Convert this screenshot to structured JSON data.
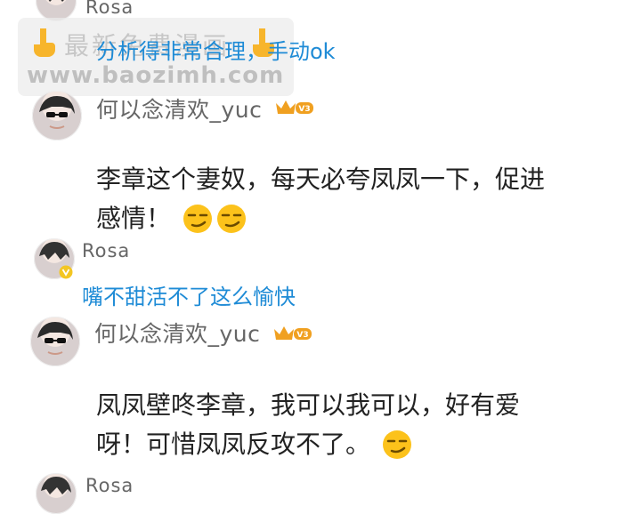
{
  "comments": [
    {
      "user": "Rosa",
      "reply": "分析得非常合理，手动ok"
    },
    {
      "user": "何以念清欢_yuc",
      "badge": "V3",
      "text_line1": "李章这个妻奴，每天必夸凤凤一下，促进",
      "text_line2": "感情！"
    },
    {
      "user": "Rosa",
      "reply": "嘴不甜活不了这么愉快"
    },
    {
      "user": "何以念清欢_yuc",
      "badge": "V3",
      "text_line1": "凤凤壁咚李章，我可以我可以，好有爱",
      "text_line2": "呀！可惜凤凤反攻不了。"
    },
    {
      "user": "Rosa"
    }
  ],
  "watermark": {
    "line1": "最新免费漫画",
    "line2": "www.baozimh.com"
  },
  "colors": {
    "reply": "#1e8bd6",
    "badge": "#f0a020",
    "name": "#666666"
  }
}
